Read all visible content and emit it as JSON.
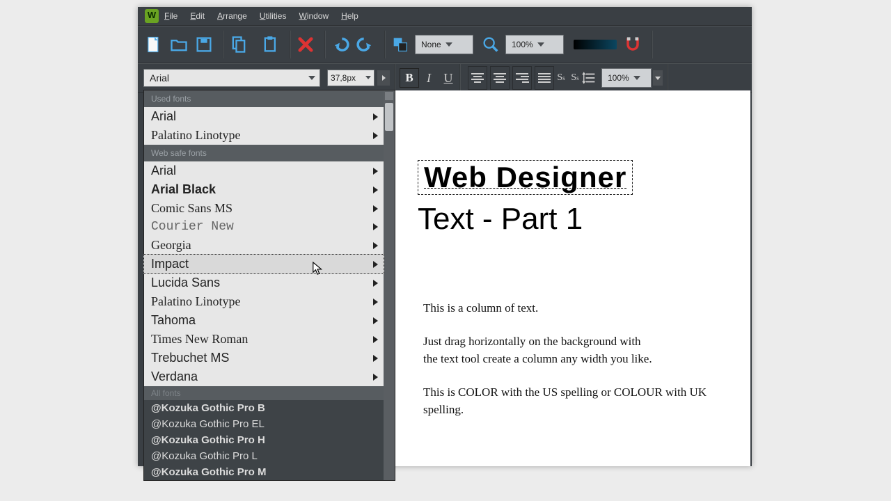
{
  "menubar": {
    "items": [
      "File",
      "Edit",
      "Arrange",
      "Utilities",
      "Window",
      "Help"
    ]
  },
  "toolbar1": {
    "snap_dd": "None",
    "zoom_dd": "100%"
  },
  "toolbar2": {
    "font": "Arial",
    "size": "37,8px",
    "line_spacing": "100%"
  },
  "fontmenu": {
    "group_used": "Used fonts",
    "used": [
      "Arial",
      "Palatino Linotype"
    ],
    "group_websafe": "Web safe fonts",
    "websafe": [
      "Arial",
      "Arial Black",
      "Comic Sans MS",
      "Courier New",
      "Georgia",
      "Impact",
      "Lucida Sans",
      "Palatino Linotype",
      "Tahoma",
      "Times New Roman",
      "Trebuchet MS",
      "Verdana"
    ],
    "group_all": "All fonts",
    "all": [
      "@Kozuka Gothic Pro B",
      "@Kozuka Gothic Pro EL",
      "@Kozuka Gothic Pro H",
      "@Kozuka Gothic Pro L",
      "@Kozuka Gothic Pro M"
    ],
    "hovered": "Impact"
  },
  "canvas": {
    "heading": "Web Designer",
    "sub": "Text - Part 1",
    "p1": "This is a column of text.",
    "p2a": "Just drag horizontally on the background with",
    "p2b": "the text tool create a column any width you like.",
    "p3": "This is COLOR with the US spelling or COLOUR with UK spelling."
  }
}
